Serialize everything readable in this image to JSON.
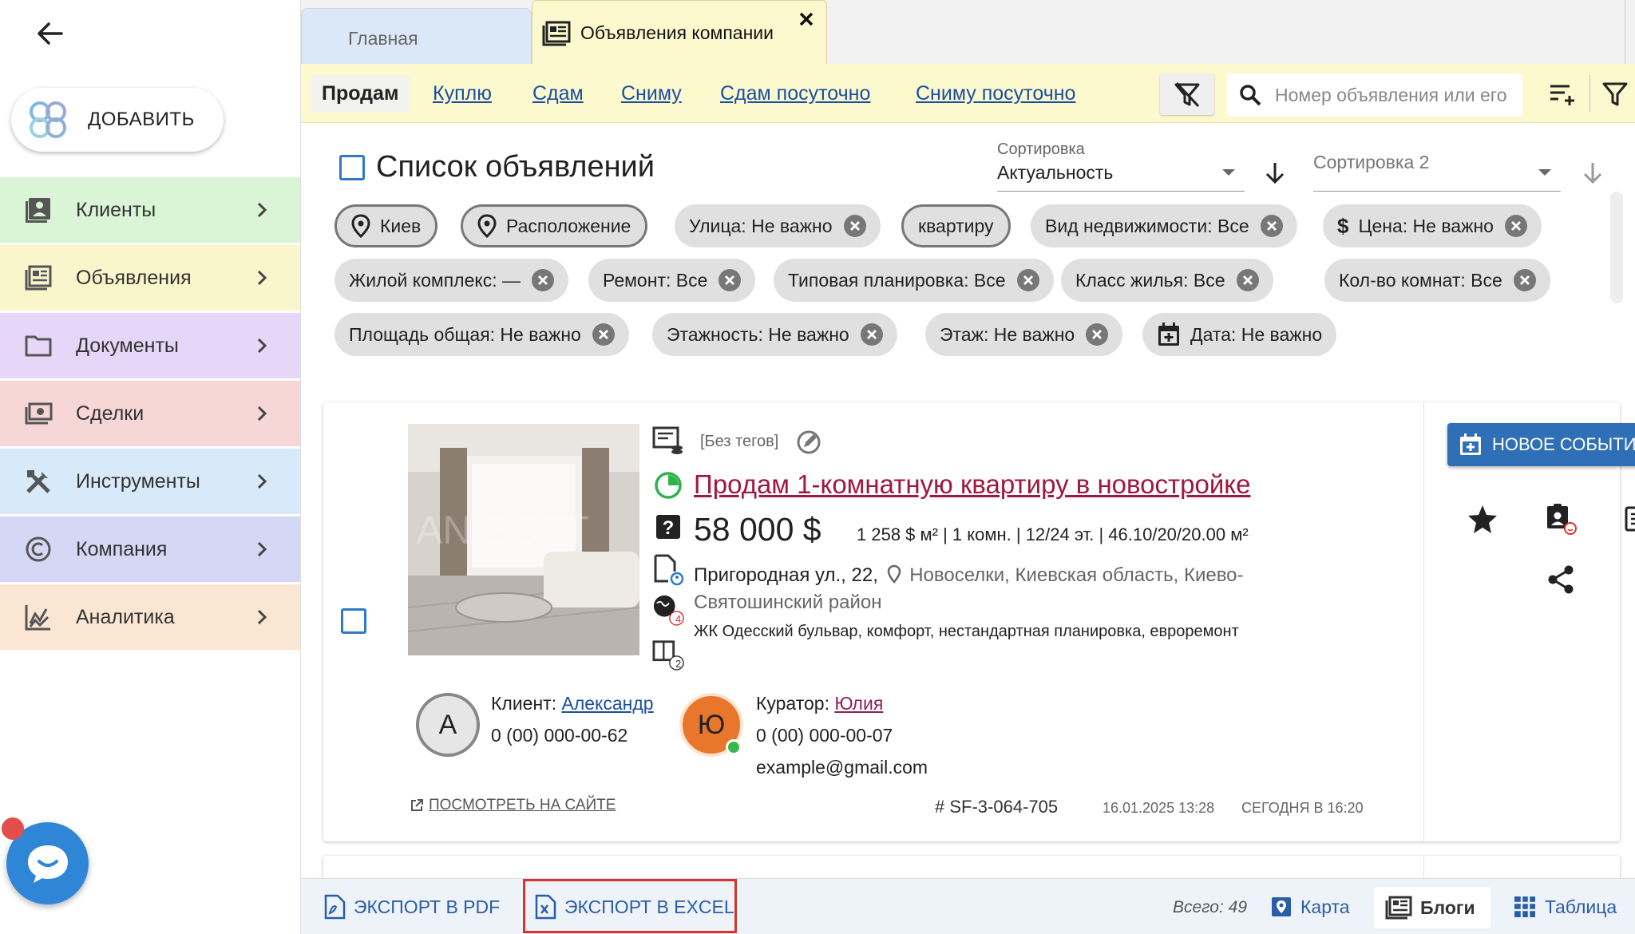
{
  "sidebar": {
    "add_label": "ДОБАВИТЬ",
    "items": [
      {
        "label": "Клиенты",
        "icon": "clients-icon",
        "bg": "#d9f5d6"
      },
      {
        "label": "Объявления",
        "icon": "listings-icon",
        "bg": "#faf6cc"
      },
      {
        "label": "Документы",
        "icon": "folder-icon",
        "bg": "#e6d6f7"
      },
      {
        "label": "Сделки",
        "icon": "money-icon",
        "bg": "#f7d6d6"
      },
      {
        "label": "Инструменты",
        "icon": "tools-icon",
        "bg": "#d8e9f9"
      },
      {
        "label": "Компания",
        "icon": "copyright-icon",
        "bg": "#d6d6f5"
      },
      {
        "label": "Аналитика",
        "icon": "analytics-icon",
        "bg": "#fae6d2"
      }
    ]
  },
  "tabs": {
    "home": "Главная",
    "active": "Объявления компании"
  },
  "categories": [
    "Продам",
    "Куплю",
    "Сдам",
    "Сниму",
    "Сдам посуточно",
    "Сниму посуточно"
  ],
  "search": {
    "placeholder": "Номер объявления или его"
  },
  "list": {
    "title": "Список объявлений",
    "sort1_label": "Сортировка",
    "sort1_value": "Актуальность",
    "sort2_placeholder": "Сортировка 2"
  },
  "chips": [
    "Киев",
    "Расположение",
    "Улица: Не важно",
    "квартиру",
    "Вид недвижимости: Все",
    "Цена: Не важно",
    "Жилой комплекс: —",
    "Ремонт: Все",
    "Типовая планировка: Все",
    "Класс жилья: Все",
    "Кол-во комнат: Все",
    "Площадь общая: Не важно",
    "Этажность: Не важно",
    "Этаж: Не важно",
    "Дата: Не важно"
  ],
  "listing": {
    "tags": "[Без тегов]",
    "title": "Продам 1-комнатную квартиру в новостройке",
    "price": "58 000 $",
    "meta": "1 258 $ м² | 1 комн. | 12/24 эт. | 46.10/20/20.00 м²",
    "street": "Пригородная ул., 22,",
    "city": "Новоселки, Киевская область, Киево-Святошинский район",
    "complex": "ЖК Одесский бульвар, комфорт, нестандартная планировка, евроремонт",
    "globe_badge": "4",
    "docs_badge": "2",
    "watermark": "ANISOFT",
    "client_label": "Клиент:",
    "client_name": "Александр",
    "client_initial": "А",
    "client_phone": "0 (00) 000-00-62",
    "curator_label": "Куратор:",
    "curator_name": "Юлия",
    "curator_initial": "Ю",
    "curator_phone": "0 (00) 000-00-07",
    "curator_email": "example@gmail.com",
    "see_site": "ПОСМОТРЕТЬ НА САЙТЕ",
    "code": "# SF-3-064-705",
    "created": "16.01.2025 13:28",
    "updated": "СЕГОДНЯ В 16:20",
    "new_event": "НОВОЕ СОБЫТИЕ"
  },
  "bottom": {
    "pdf": "ЭКСПОРТ В PDF",
    "excel": "ЭКСПОРТ В EXCEL",
    "total": "Всего: 49",
    "map": "Карта",
    "blogs": "Блоги",
    "table": "Таблица"
  },
  "colors": {
    "accent": "#2f6fb8",
    "title_link": "#a0173f",
    "highlight": "#d9342b",
    "tab_yellow": "#fdf9cf",
    "curator_avatar": "#e8762b"
  }
}
